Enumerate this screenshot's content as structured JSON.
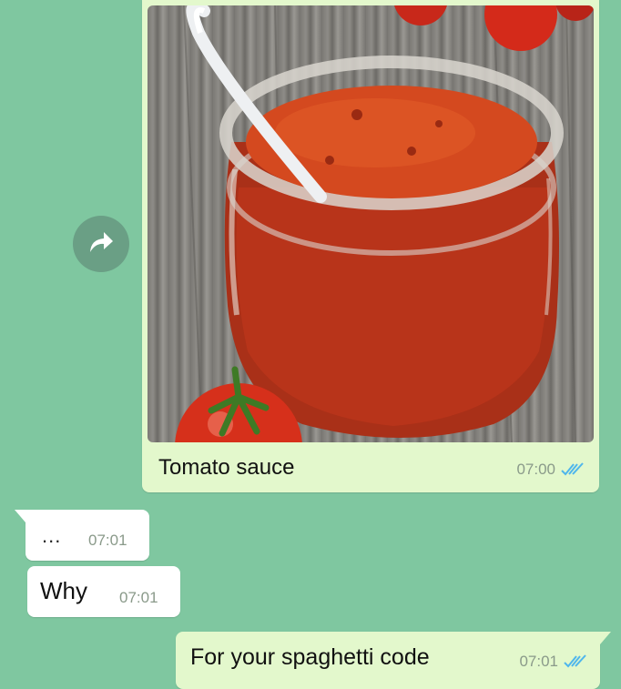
{
  "colors": {
    "background": "#7fc7a0",
    "outgoing_bubble": "#e3f8cc",
    "incoming_bubble": "#ffffff",
    "read_ticks": "#4fb6ec",
    "timestamp": "#8a9a8a"
  },
  "image_message": {
    "caption": "Tomato sauce",
    "time": "07:00",
    "status_icon": "double-check-read-icon",
    "photo_subject": "jar of tomato sauce with spoon and cherry tomatoes"
  },
  "forward_button": {
    "icon": "forward-arrow-icon"
  },
  "incoming_messages": [
    {
      "text": "...",
      "time": "07:01"
    },
    {
      "text": "Why",
      "time": "07:01"
    }
  ],
  "outgoing_message": {
    "text": "For your spaghetti code",
    "time": "07:01",
    "status_icon": "double-check-read-icon"
  }
}
